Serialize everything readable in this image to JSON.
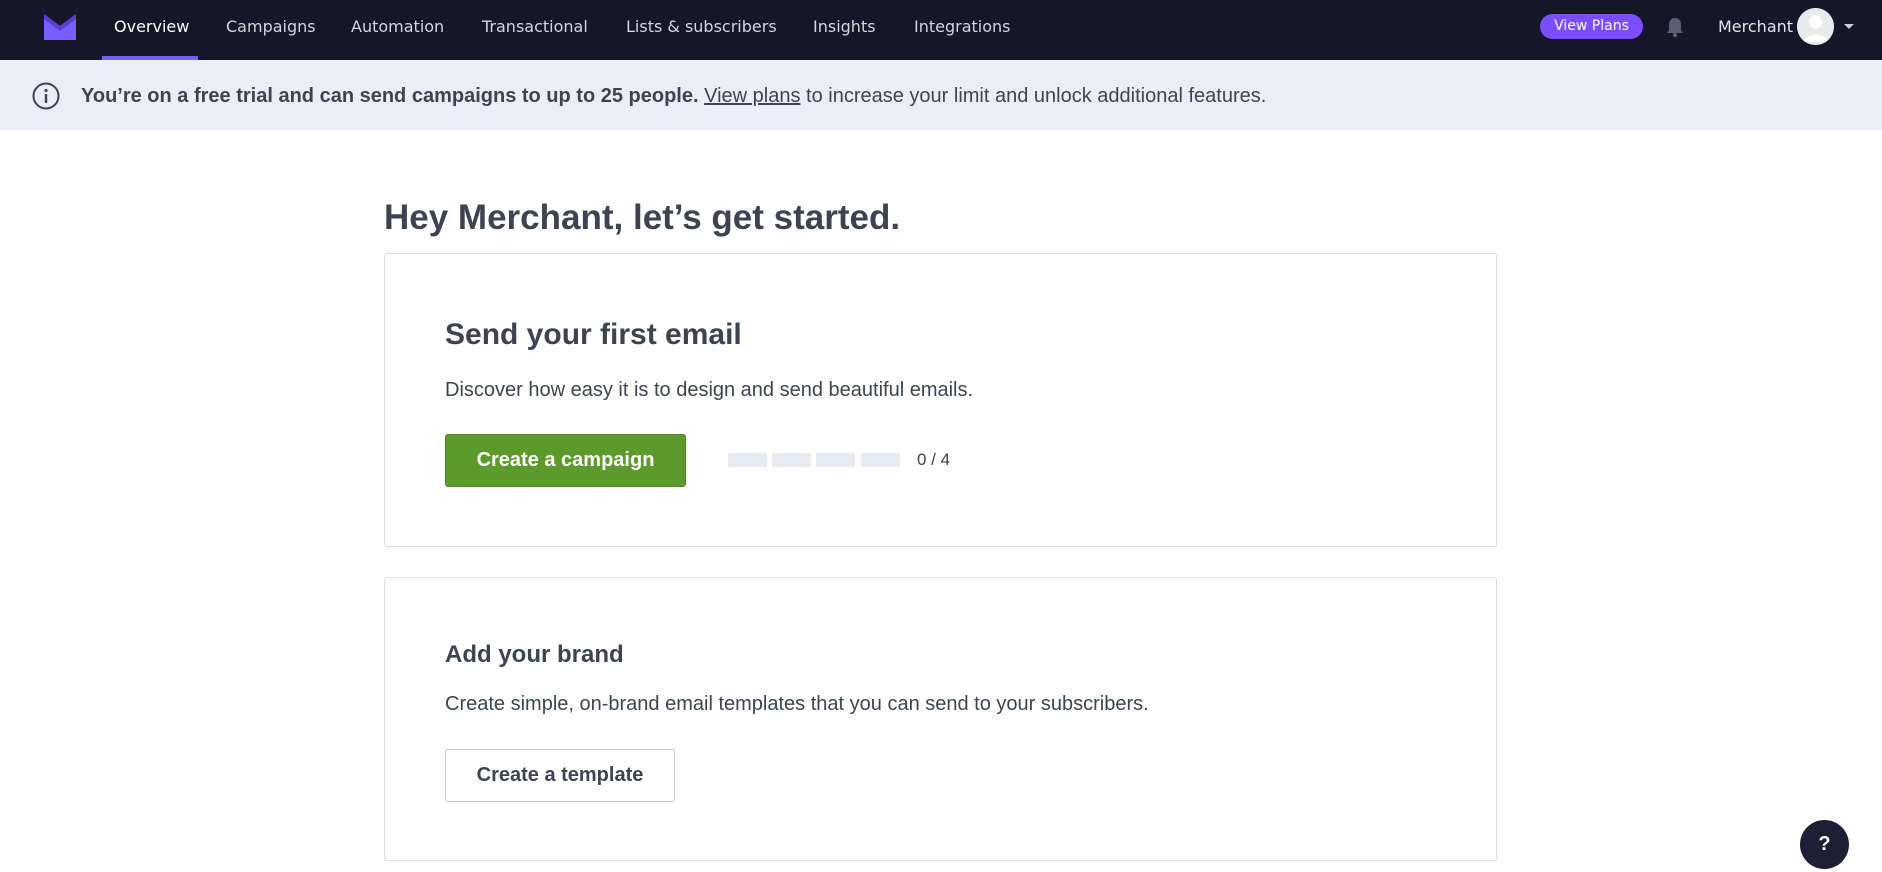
{
  "nav": {
    "tabs": [
      {
        "label": "Overview",
        "active": true
      },
      {
        "label": "Campaigns"
      },
      {
        "label": "Automation"
      },
      {
        "label": "Transactional"
      },
      {
        "label": "Lists & subscribers"
      },
      {
        "label": "Insights"
      },
      {
        "label": "Integrations"
      }
    ],
    "view_plans_label": "View Plans",
    "user_name": "Merchant",
    "icons": [
      "mail-logo-icon",
      "bell-icon",
      "user-avatar-icon",
      "caret-down-icon"
    ]
  },
  "banner": {
    "bold_text": "You’re on a free trial and can send campaigns to up to 25 people.",
    "link_text": "View plans",
    "trailing_text": " to increase your limit and unlock additional features.",
    "icon": "info-icon"
  },
  "main": {
    "greeting": "Hey Merchant, let’s get started.",
    "cards": [
      {
        "title": "Send your first email",
        "description": "Discover how easy it is to design and send beautiful emails.",
        "button_label": "Create a campaign",
        "progress": {
          "completed": 0,
          "total": 4,
          "label": "0 / 4"
        }
      },
      {
        "title": "Add your brand",
        "description": "Create simple, on-brand email templates that you can send to your subscribers.",
        "button_label": "Create a template"
      }
    ]
  },
  "help": {
    "label": "?"
  },
  "colors": {
    "topbar": "#151729",
    "accent": "#7a4dff",
    "banner_bg": "#e9eef8",
    "primary_button": "#5d9a2c",
    "text": "#3e4351"
  }
}
